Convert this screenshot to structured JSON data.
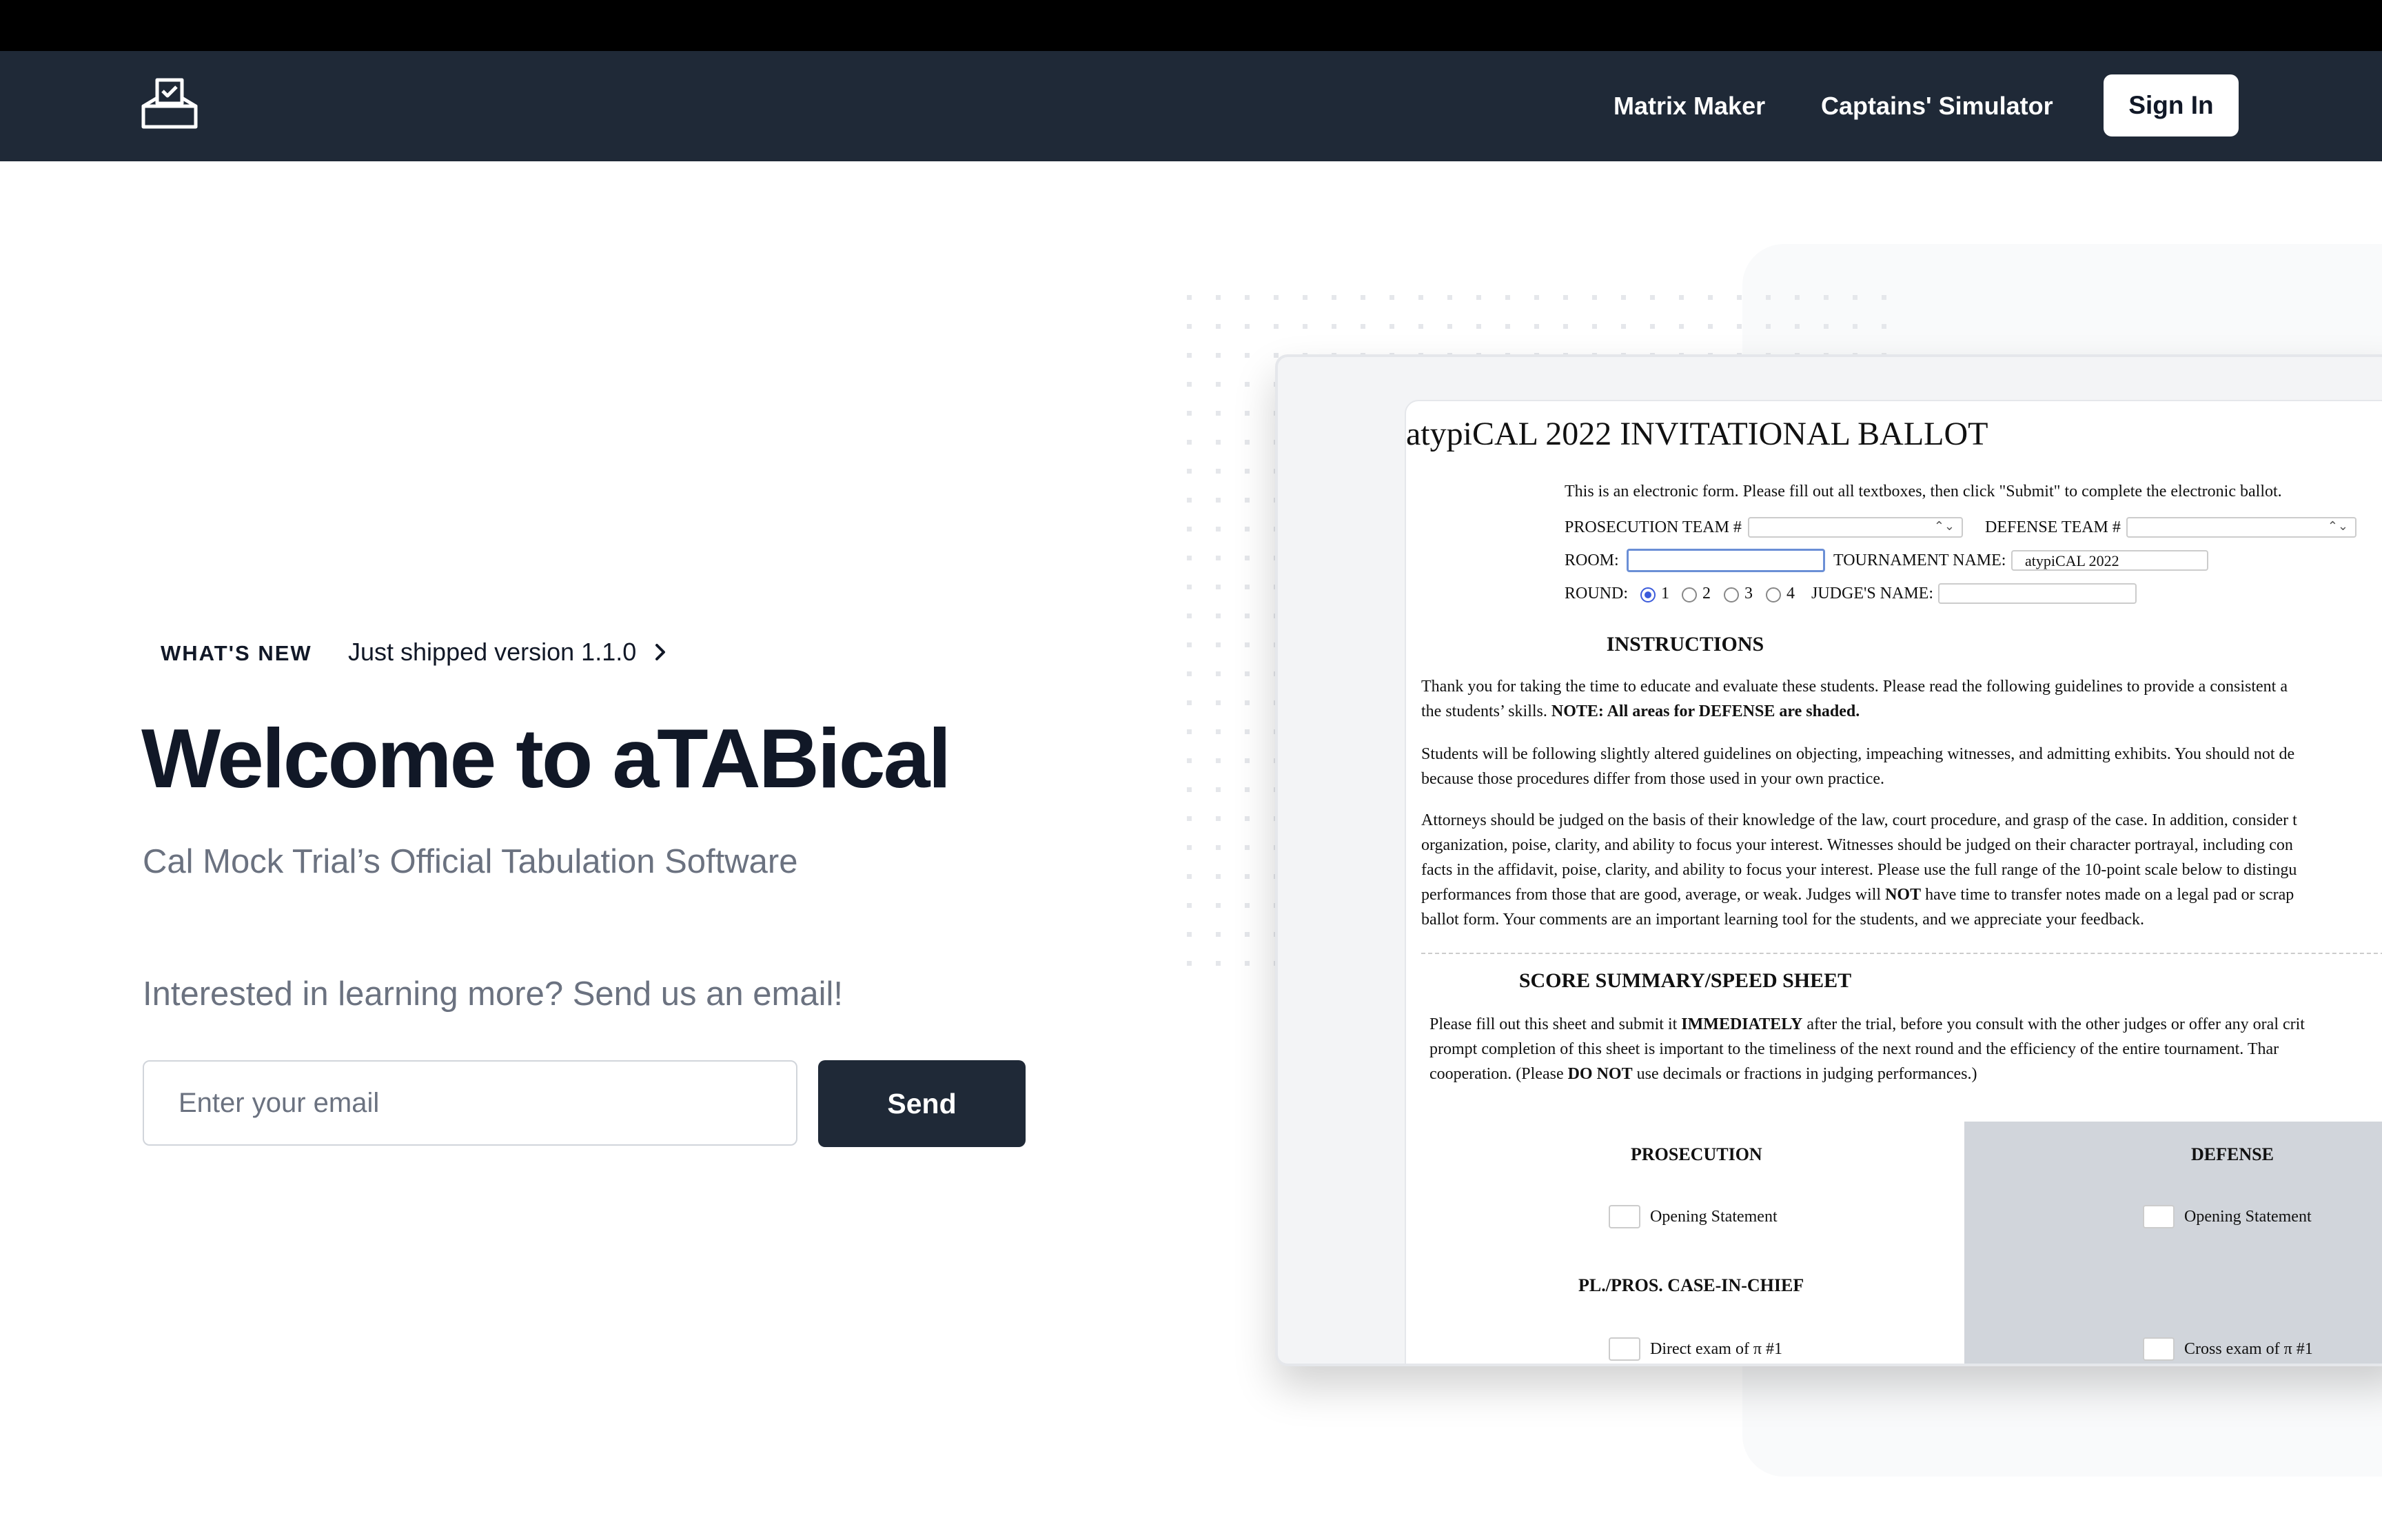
{
  "nav": {
    "logo_icon": "ballot-box-icon",
    "links": [
      "Matrix Maker",
      "Captains' Simulator"
    ],
    "sign_in": "Sign In"
  },
  "hero": {
    "badge": "WHAT'S NEW",
    "announcement": "Just shipped version 1.1.0",
    "title": "Welcome to aTABical",
    "subtitle": "Cal Mock Trial’s Official Tabulation Software",
    "cta_text": "Interested in learning more? Send us an email!",
    "email_placeholder": "Enter your email",
    "send_label": "Send"
  },
  "ballot": {
    "title": "atypiCAL 2022 INVITATIONAL BALLOT",
    "intro": "This is an electronic form. Please fill out all textboxes, then click \"Submit\" to complete the electronic ballot.",
    "prosecution_team_label": "PROSECUTION TEAM #",
    "defense_team_label": "DEFENSE TEAM #",
    "room_label": "ROOM:",
    "tournament_label": "TOURNAMENT NAME:",
    "tournament_value": "atypiCAL 2022",
    "round_label": "ROUND:",
    "round_options": [
      "1",
      "2",
      "3",
      "4"
    ],
    "round_selected": "1",
    "judge_label": "JUDGE'S NAME:",
    "instructions_heading": "INSTRUCTIONS",
    "para1": "Thank you for taking the time to educate and evaluate these students. Please read the following guidelines to provide a consistent a",
    "para1b": "the students’ skills.",
    "para1c": "NOTE: All areas for DEFENSE are shaded.",
    "para2": "Students will be following slightly altered guidelines on objecting, impeaching witnesses, and admitting exhibits. You should not de",
    "para2b": "because those procedures differ from those used in your own practice.",
    "para3": "Attorneys should be judged on the basis of their knowledge of the law, court procedure, and grasp of the case. In addition, consider t",
    "para3b": "organization, poise, clarity, and ability to focus your interest. Witnesses should be judged on their character portrayal, including con",
    "para3c": "facts in the affidavit, poise, clarity, and ability to focus your interest. Please use the full range of the 10-point scale below to distingu",
    "para3d_a": "performances from those that are good, average, or weak. Judges will",
    "para3d_b": "NOT",
    "para3d_c": "have time to transfer notes made on a legal pad or scrap",
    "para3e": "ballot form. Your comments are an important learning tool for the students, and we appreciate your feedback.",
    "summary_heading": "SCORE SUMMARY/SPEED SHEET",
    "summary_a": "Please fill out this sheet and submit it",
    "summary_b": "IMMEDIATELY",
    "summary_c": "after the trial, before you consult with the other judges or offer any oral crit",
    "summary_d": "prompt completion of this sheet is important to the timeliness of the next round and the efficiency of the entire tournament. Thar",
    "summary_e": "cooperation. (Please",
    "summary_f": "DO NOT",
    "summary_g": "use decimals or fractions in judging performances.)",
    "prosecution_head": "PROSECUTION",
    "defense_head": "DEFENSE",
    "pros_opening": "Opening Statement",
    "def_opening": "Opening Statement",
    "case_in_chief": "PL./PROS. CASE-IN-CHIEF",
    "pros_direct": "Direct exam of π #1",
    "def_cross": "Cross exam of π #1"
  }
}
